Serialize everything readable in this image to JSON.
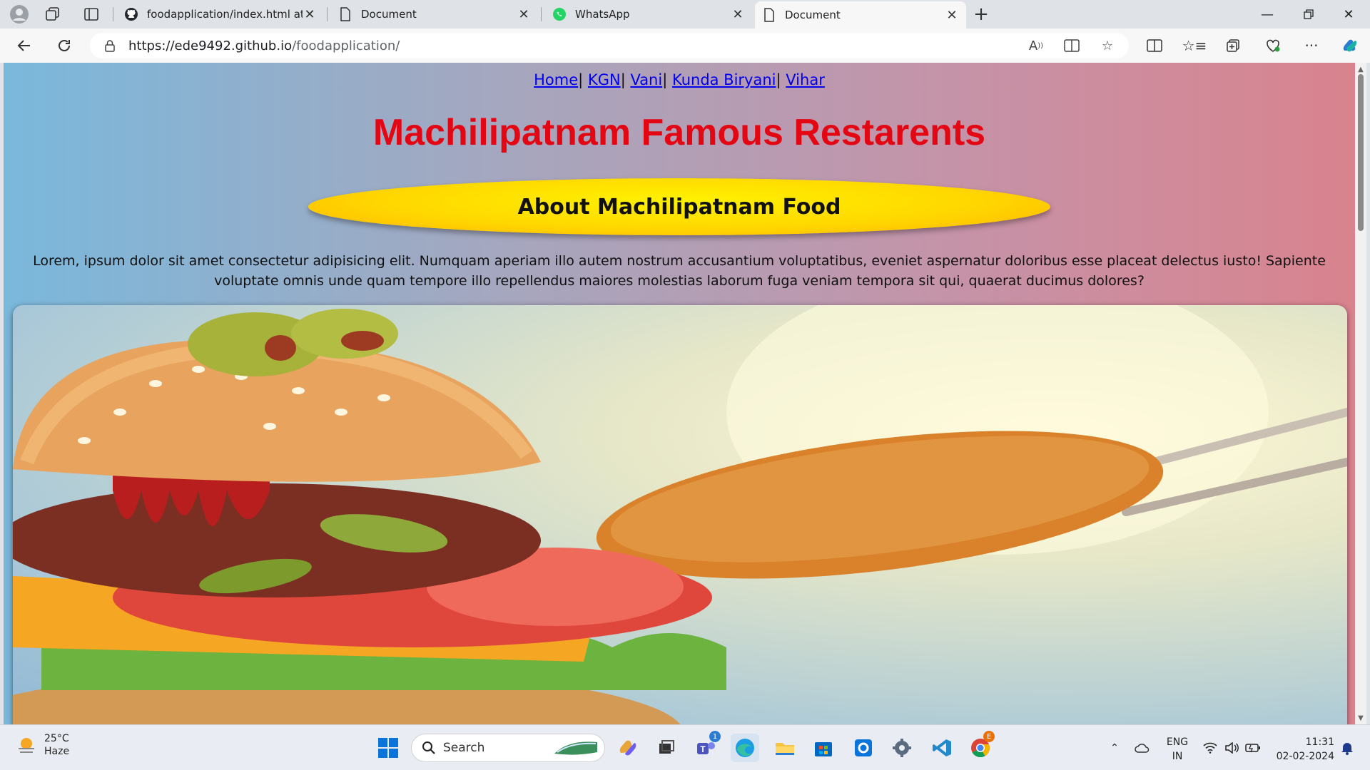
{
  "browser": {
    "tabs": [
      {
        "label": "foodapplication/index.html at ma",
        "icon": "github-icon"
      },
      {
        "label": "Document",
        "icon": "document-icon"
      },
      {
        "label": "WhatsApp",
        "icon": "whatsapp-icon"
      },
      {
        "label": "Document",
        "icon": "document-icon"
      }
    ],
    "active_tab": 3,
    "url_host": "https://ede9492.github.io",
    "url_path": "/foodapplication/"
  },
  "page": {
    "nav": [
      "Home",
      "KGN",
      "Vani",
      "Kunda Biryani",
      "Vihar"
    ],
    "nav_separator": "|",
    "title": "Machilipatnam Famous Restarents",
    "subtitle": "About Machilipatnam Food",
    "paragraph": "Lorem, ipsum dolor sit amet consectetur adipisicing elit. Numquam aperiam illo autem nostrum accusantium voluptatibus, eveniet aspernatur doloribus esse placeat delectus iusto! Sapiente voluptate omnis unde quam tempore illo repellendus maiores molestias laborum fuga veniam tempora sit qui, quaerat ducimus dolores?",
    "title_color": "#e30613",
    "oval_color": "#ffd800"
  },
  "taskbar": {
    "weather_temp": "25°C",
    "weather_desc": "Haze",
    "search_label": "Search",
    "lang_line1": "ENG",
    "lang_line2": "IN",
    "time": "11:31",
    "date": "02-02-2024",
    "teams_badge": "1",
    "chrome_badge": "E"
  }
}
